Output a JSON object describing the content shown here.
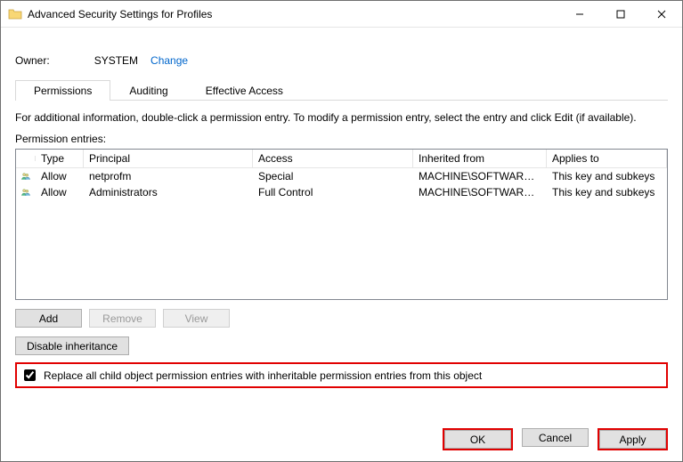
{
  "window": {
    "title": "Advanced Security Settings for Profiles"
  },
  "owner": {
    "label": "Owner:",
    "value": "SYSTEM",
    "change": "Change"
  },
  "tabs": {
    "permissions": "Permissions",
    "auditing": "Auditing",
    "effective": "Effective Access"
  },
  "info": "For additional information, double-click a permission entry. To modify a permission entry, select the entry and click Edit (if available).",
  "entries_label": "Permission entries:",
  "grid": {
    "headers": {
      "type": "Type",
      "principal": "Principal",
      "access": "Access",
      "inherited": "Inherited from",
      "applies": "Applies to"
    },
    "rows": [
      {
        "type": "Allow",
        "principal": "netprofm",
        "access": "Special",
        "inherited": "MACHINE\\SOFTWARE…",
        "applies": "This key and subkeys"
      },
      {
        "type": "Allow",
        "principal": "Administrators",
        "access": "Full Control",
        "inherited": "MACHINE\\SOFTWARE…",
        "applies": "This key and subkeys"
      }
    ]
  },
  "buttons": {
    "add": "Add",
    "remove": "Remove",
    "view": "View",
    "disable_inh": "Disable inheritance",
    "ok": "OK",
    "cancel": "Cancel",
    "apply": "Apply"
  },
  "replace": {
    "checked": true,
    "label": "Replace all child object permission entries with inheritable permission entries from this object"
  }
}
